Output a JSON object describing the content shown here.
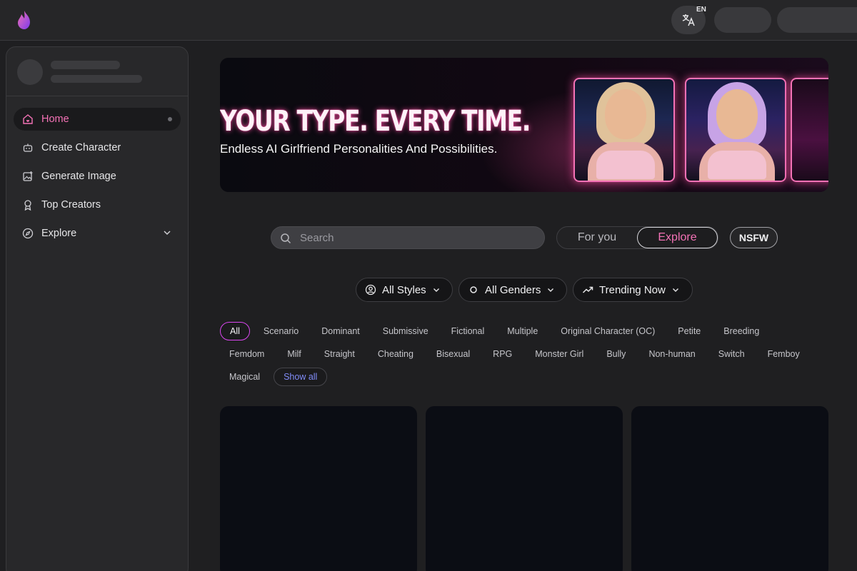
{
  "header": {
    "language_code": "EN"
  },
  "sidebar": {
    "items": [
      {
        "label": "Home",
        "icon": "home-icon",
        "active": true
      },
      {
        "label": "Create Character",
        "icon": "robot-icon"
      },
      {
        "label": "Generate Image",
        "icon": "image-plus-icon"
      },
      {
        "label": "Top Creators",
        "icon": "award-icon"
      },
      {
        "label": "Explore",
        "icon": "compass-icon"
      }
    ]
  },
  "banner": {
    "headline": "YOUR TYPE. EVERY TIME.",
    "subheadline": "Endless AI Girlfriend Personalities And Possibilities."
  },
  "search": {
    "placeholder": "Search"
  },
  "feed_toggle": {
    "options": [
      "For you",
      "Explore"
    ],
    "selected": "Explore"
  },
  "nsfw_label": "NSFW",
  "filters": {
    "styles": "All Styles",
    "genders": "All Genders",
    "sort": "Trending Now"
  },
  "tags": {
    "row1": [
      "All",
      "Scenario",
      "Dominant",
      "Submissive",
      "Fictional",
      "Multiple",
      "Original Character (OC)",
      "Petite",
      "Breeding"
    ],
    "row2": [
      "Femdom",
      "Milf",
      "Straight",
      "Cheating",
      "Bisexual",
      "RPG",
      "Monster Girl",
      "Bully",
      "Non-human",
      "Switch",
      "Femboy"
    ],
    "row3": [
      "Magical"
    ],
    "show_all": "Show all",
    "selected": "All"
  },
  "colors": {
    "accent": "#f472b6",
    "link": "#818cf8",
    "background": "#1f1f21"
  }
}
